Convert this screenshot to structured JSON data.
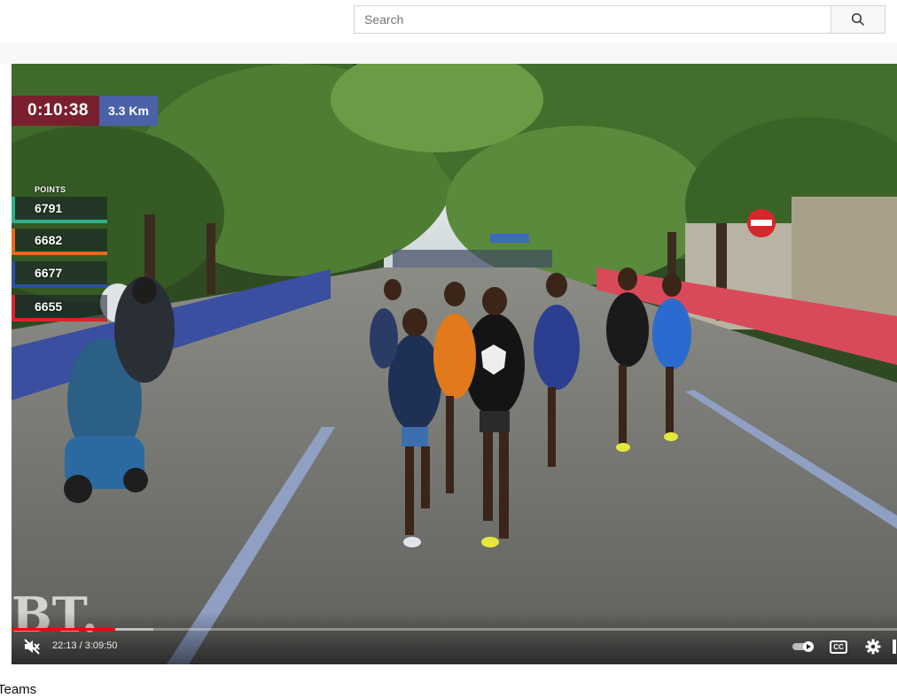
{
  "search": {
    "placeholder": "Search",
    "value": "",
    "icon": "search-icon"
  },
  "video": {
    "overlay": {
      "elapsed": "0:10:38",
      "distance": "3.3 Km",
      "points_title": "POINTS",
      "standings": [
        {
          "points": "6791",
          "color": "#2fae8a"
        },
        {
          "points": "6682",
          "color": "#e86a1c"
        },
        {
          "points": "6677",
          "color": "#2b4fa8"
        },
        {
          "points": "6655",
          "color": "#d6262a"
        }
      ],
      "watermark": "BT."
    },
    "controls": {
      "time": "22:13 / 3:09:50",
      "progress": 0.117,
      "muted_icon": "volume-muted-icon",
      "autoplay_icon": "autoplay-toggle-icon",
      "cc_label": "CC",
      "settings_icon": "gear-icon"
    },
    "colors": {
      "accent": "#ff0000"
    }
  },
  "below": {
    "title_fragment": "Teams"
  }
}
